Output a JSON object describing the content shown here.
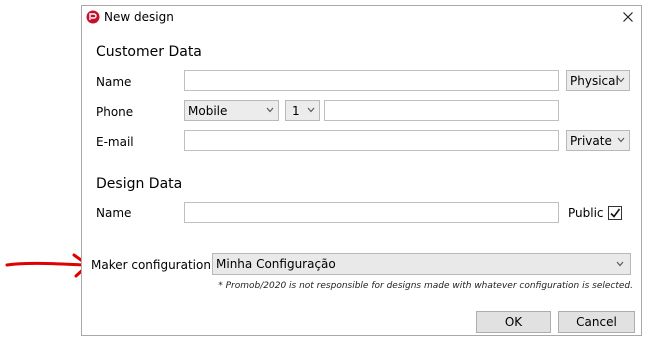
{
  "window": {
    "title": "New design"
  },
  "customer": {
    "section_title": "Customer Data",
    "name_label": "Name",
    "name_value": "",
    "name_type": "Physical",
    "phone_label": "Phone",
    "phone_type": "Mobile",
    "phone_index": "1",
    "phone_value": "",
    "email_label": "E-mail",
    "email_value": "",
    "email_type": "Private"
  },
  "design": {
    "section_title": "Design Data",
    "name_label": "Name",
    "name_value": "",
    "public_label": "Public",
    "public_checked": true
  },
  "maker": {
    "label": "Maker configuration *",
    "value": "Minha Configuração",
    "note": "* Promob/2020 is not responsible for designs made with whatever configuration is selected."
  },
  "buttons": {
    "ok": "OK",
    "cancel": "Cancel"
  },
  "colors": {
    "annotation_arrow": "#e00000",
    "app_icon": "#c8102e"
  }
}
